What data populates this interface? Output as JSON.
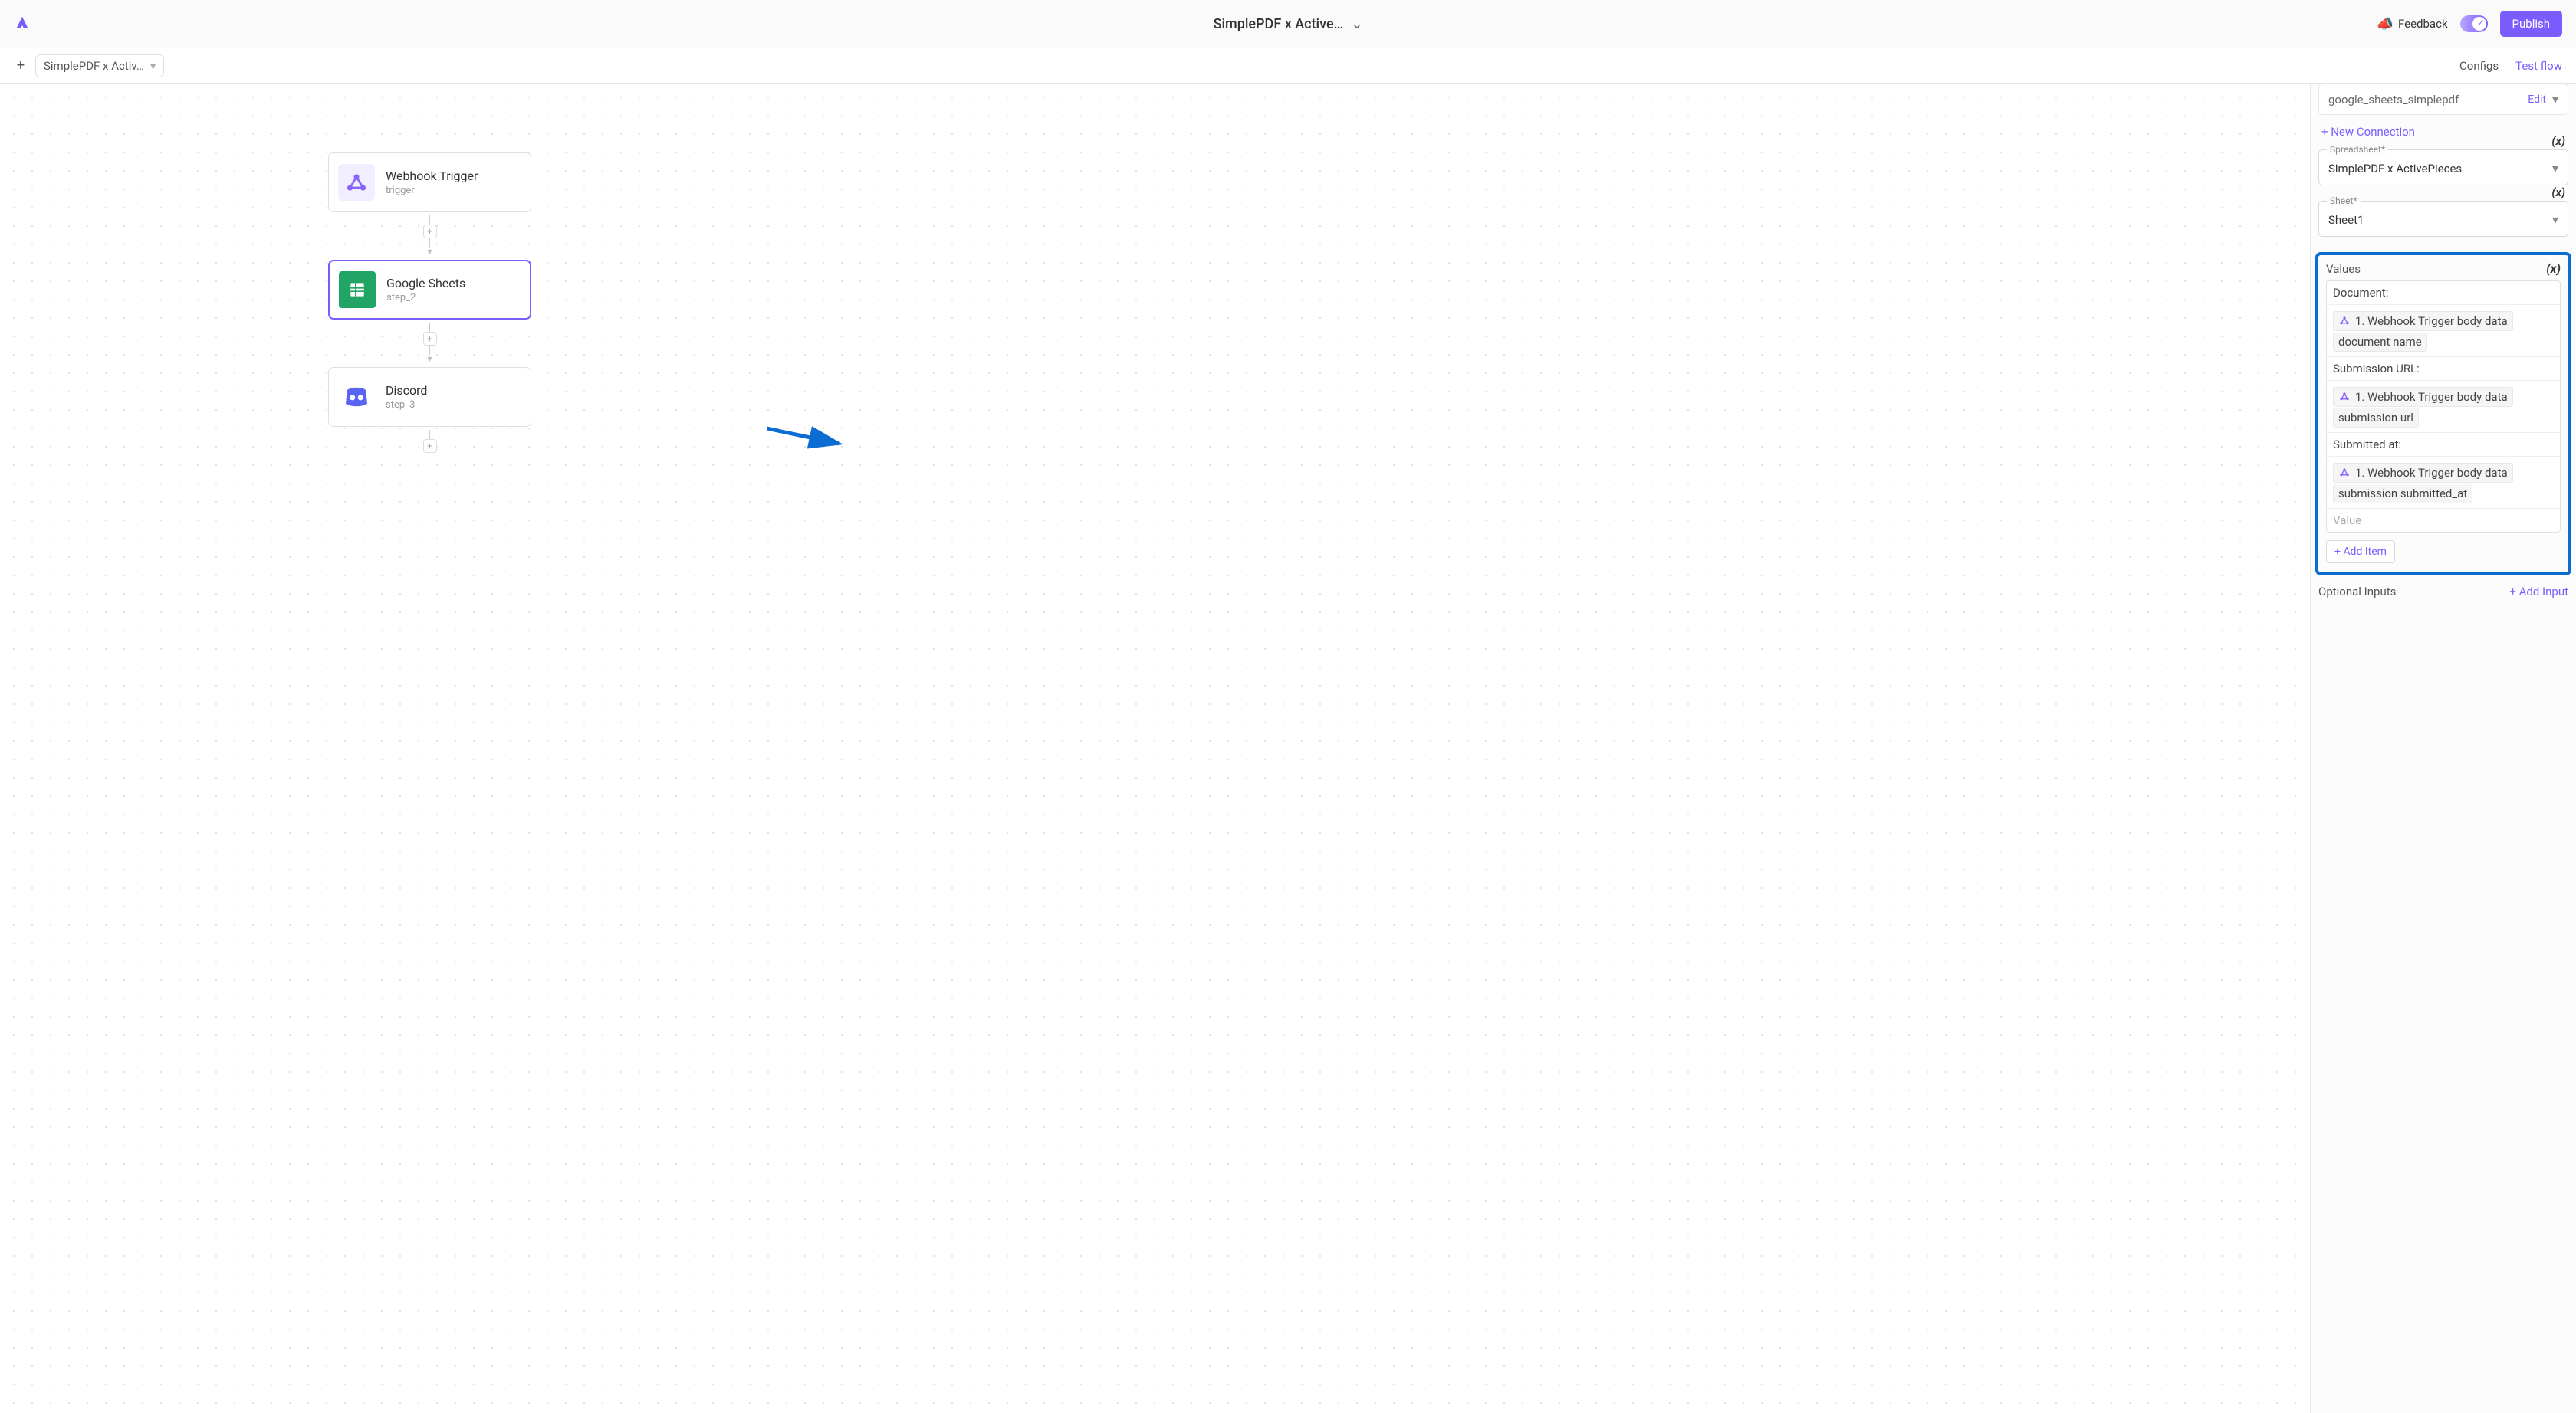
{
  "header": {
    "title": "SimplePDF x Active…",
    "feedback": "Feedback",
    "publish": "Publish"
  },
  "subbar": {
    "tab": "SimplePDF x Activ…",
    "configs": "Configs",
    "testflow": "Test flow"
  },
  "cards": {
    "webhook": {
      "title": "Webhook Trigger",
      "sub": "trigger"
    },
    "sheets": {
      "title": "Google Sheets",
      "sub": "step_2"
    },
    "discord": {
      "title": "Discord",
      "sub": "step_3"
    }
  },
  "sidebar": {
    "connection": {
      "name": "google_sheets_simplepdf",
      "edit": "Edit"
    },
    "newConnection": "+ New Connection",
    "spreadsheet": {
      "label": "Spreadsheet*",
      "value": "SimplePDF x ActivePieces",
      "varBadge": "(x)"
    },
    "sheet": {
      "label": "Sheet*",
      "value": "Sheet1",
      "varBadge": "(x)"
    },
    "values": {
      "header": "Values",
      "varBadge": "(x)",
      "rows": [
        {
          "label": "Document:",
          "pill": "1. Webhook Trigger body data",
          "tail": "document name"
        },
        {
          "label": "Submission URL:",
          "pill": "1. Webhook Trigger body data",
          "tail": "submission url"
        },
        {
          "label": "Submitted at:",
          "pill": "1. Webhook Trigger body data",
          "tail": "submission submitted_at"
        }
      ],
      "placeholder": "Value",
      "addItem": "+ Add Item"
    },
    "optionalInputs": "Optional Inputs",
    "addInput": "+ Add Input"
  }
}
